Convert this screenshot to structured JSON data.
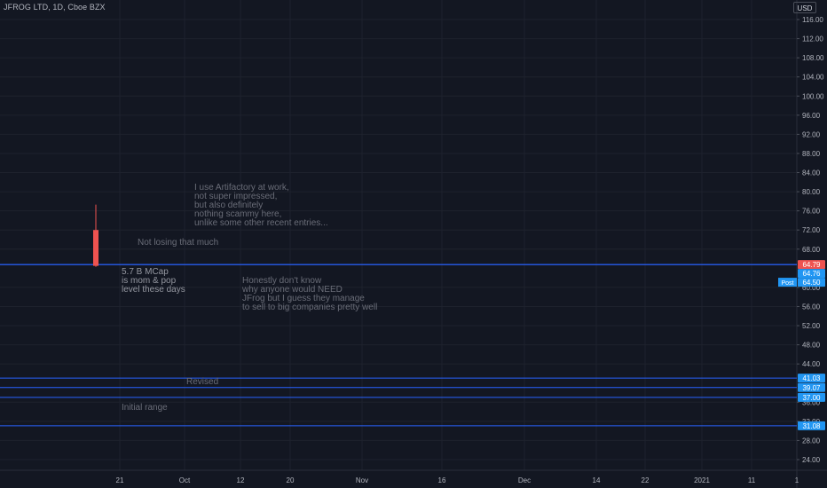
{
  "header": {
    "symbol_title": "JFROG LTD, 1D, Cboe BZX",
    "currency": "USD"
  },
  "price_axis": {
    "ticks": [
      "116.00",
      "112.00",
      "108.00",
      "104.00",
      "100.00",
      "96.00",
      "92.00",
      "88.00",
      "84.00",
      "80.00",
      "76.00",
      "72.00",
      "68.00",
      "60.00",
      "56.00",
      "52.00",
      "48.00",
      "44.00",
      "36.00",
      "32.00",
      "28.00",
      "24.00"
    ],
    "tick_values": [
      116,
      112,
      108,
      104,
      100,
      96,
      92,
      88,
      84,
      80,
      76,
      72,
      68,
      60,
      56,
      52,
      48,
      44,
      36,
      32,
      28,
      24
    ]
  },
  "time_axis": {
    "labels": [
      "21",
      "Oct",
      "12",
      "20",
      "Nov",
      "16",
      "Dec",
      "14",
      "22",
      "2021",
      "11",
      "1"
    ]
  },
  "candle": {
    "open": 72.0,
    "close": 64.5,
    "high": 77.3,
    "low": 64.3,
    "color": "#ef5350"
  },
  "horizontal_lines": {
    "color": "#2962ff",
    "values": [
      64.79,
      64.76,
      41.03,
      39.07,
      37.0,
      31.08
    ]
  },
  "price_badges": [
    {
      "label": "64.79",
      "value": 64.79,
      "color": "#ef5350"
    },
    {
      "label": "64.76",
      "value": 64.76,
      "color": "#2196f3"
    },
    {
      "label": "64.50",
      "value": 64.5,
      "color": "#2196f3"
    },
    {
      "label": "41.03",
      "value": 41.03,
      "color": "#2196f3"
    },
    {
      "label": "39.07",
      "value": 39.07,
      "color": "#2196f3"
    },
    {
      "label": "37.00",
      "value": 37.0,
      "color": "#2196f3"
    },
    {
      "label": "31.08",
      "value": 31.08,
      "color": "#2196f3"
    }
  ],
  "post_market_label": "Post",
  "annotations": {
    "artifactory": "I use Artifactory at work,\nnot super impressed,\nbut also definitely\nnothing scammy here,\nunlike some other recent entries...",
    "not_losing": "Not losing that much",
    "mcap": "5.7 B MCap\nis mom & pop\nlevel these days",
    "need": "Honestly don't know\nwhy anyone would NEED\nJFrog but I guess they manage\nto sell to big companies pretty well",
    "revised": "Revised",
    "initial_range": "Initial range"
  }
}
